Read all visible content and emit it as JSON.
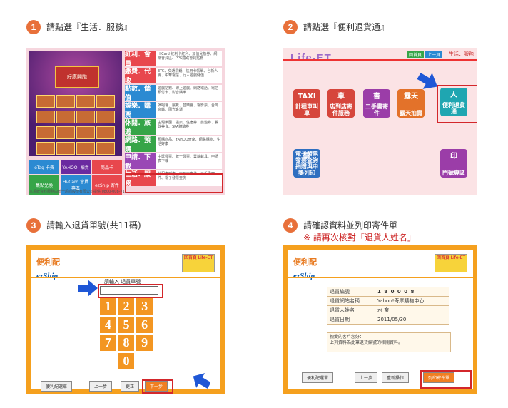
{
  "steps": {
    "s1": {
      "num": "1",
      "text": "請點選『生活．服務』"
    },
    "s2": {
      "num": "2",
      "text": "請點選『便利退貨通』"
    },
    "s3": {
      "num": "3",
      "text": "請輸入退貨單號(共11碼)"
    },
    "s4": {
      "num": "4",
      "text": "請確認資料並列印寄件單",
      "warning": "※ 請再次核對「退貨人姓名」"
    }
  },
  "panel1": {
    "menu": [
      {
        "label": "紅利．會員",
        "color": "#e8474d",
        "desc": "HiCard‧紅利卡紅利、加值兌換券、網購會員區、PPS鐵路會員點數"
      },
      {
        "label": "繳費．代收",
        "color": "#e8474d",
        "desc": "ETC、交通罰鍰、信用卡帳單、台新人壽、中華電信、行人遊戲儲值"
      },
      {
        "label": "點數．儲值",
        "color": "#2b8ad2",
        "desc": "遊戲點數、線上遊戲、網路電話、電信預付卡、影音娛樂"
      },
      {
        "label": "娛樂．購票",
        "color": "#2b8ad2",
        "desc": "演唱會、展覽、音樂會、電影票、台灣高鐵、國光客運"
      },
      {
        "label": "休閒．旅遊",
        "color": "#36a548",
        "desc": "主題樂園、溫泉、住宿券、旅遊券、餐飲美食、SPA體驗券"
      },
      {
        "label": "網路．預購",
        "color": "#36a548",
        "desc": "預購商品、YAHOO奇摩、網路購物、生活好康"
      },
      {
        "label": "申請．下載",
        "color": "#9a48b5",
        "desc": "中獎發票、統一發票、雲端載具、申請表下載"
      },
      {
        "label": "生活．服務",
        "color": "#e8474d",
        "desc": "計程車叫車、店到店寄件、二手書寄件、電子發票查詢"
      }
    ],
    "tiles": [
      {
        "label": "eTag 卡費",
        "color": "#2b8ad2"
      },
      {
        "label": "YAHOO! 拍賣",
        "color": "#6a2aa0"
      },
      {
        "label": "商品卡",
        "color": "#e8474d"
      },
      {
        "label": "集點兌換",
        "color": "#36a548"
      },
      {
        "label": "Hi-Card 會員專區",
        "color": "#2b8ad2"
      },
      {
        "label": "ezShip 寄件",
        "color": "#e8474d"
      }
    ],
    "promo_title": "好康開跑",
    "footer": "本系統資料服務由統一超商股份有限公司提供 0800-008-711"
  },
  "panel2": {
    "logo": "Life-ET",
    "nav": [
      "回首頁",
      "上一頁"
    ],
    "crumb": "生活．服務",
    "icons": [
      {
        "label": "計程車叫車",
        "glyph": "TAXI",
        "color": "#d6463c"
      },
      {
        "label": "店到店寄件服務",
        "glyph": "車",
        "color": "#d6463c"
      },
      {
        "label": "二手書寄件",
        "glyph": "書",
        "color": "#9b3da8"
      },
      {
        "label": "露天拍賣",
        "glyph": "露天",
        "color": "#e3722a"
      },
      {
        "label": "便利退貨通",
        "glyph": "人",
        "color": "#1fa6b1"
      },
      {
        "label": "電子發票發票查詢捐贈與中獎列印",
        "glyph": "票",
        "color": "#2f6fc0"
      },
      {
        "label": "門號專區",
        "glyph": "印",
        "color": "#9b3da8"
      }
    ]
  },
  "panel3": {
    "logo_cn": "便利配",
    "logo_en": "ezShip",
    "badge": "回首頁 Life-ET",
    "input_label": "請輸入 退貨單號",
    "keys": [
      "1",
      "2",
      "3",
      "4",
      "5",
      "6",
      "7",
      "8",
      "9",
      "0"
    ],
    "buttons": [
      "便利配選單",
      "上一步",
      "更正",
      "下一步"
    ]
  },
  "panel4": {
    "logo_cn": "便利配",
    "logo_en": "ezShip",
    "badge": "回首頁 Life-ET",
    "rows": [
      {
        "k": "退貨編號",
        "v": "1 8 0 0 0 8"
      },
      {
        "k": "退貨網站名稱",
        "v": "Yahoo!奇摩購物中心"
      },
      {
        "k": "退貨人姓名",
        "v": "水 奈"
      },
      {
        "k": "退貨日期",
        "v": "2011/05/30"
      }
    ],
    "note1": "親愛的客戶您好：",
    "note2": "上列資料為此筆退貨編號的相關資料。",
    "buttons": [
      "便利配選單",
      "上一步",
      "重新操作",
      "列印寄件單"
    ]
  }
}
